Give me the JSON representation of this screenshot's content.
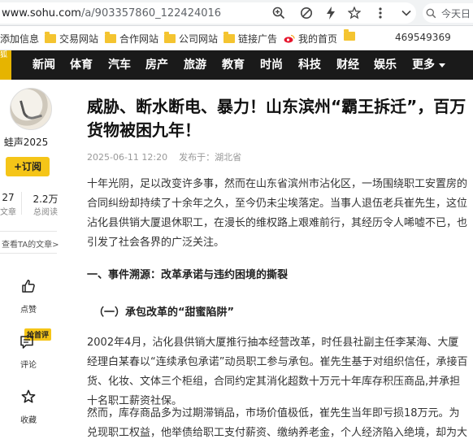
{
  "browser": {
    "url_host": "www.sohu.com",
    "url_path": "/a/903357860_122424016",
    "search_hint": "今天日"
  },
  "bookmarks": [
    {
      "label": "添加信息",
      "folder": false
    },
    {
      "label": "交易网站",
      "folder": true
    },
    {
      "label": "合作网站",
      "folder": true
    },
    {
      "label": "公司网站",
      "folder": true
    },
    {
      "label": "链接广告",
      "folder": true
    },
    {
      "label": "我的首页",
      "folder": false
    },
    {
      "label": "",
      "folder": true
    },
    {
      "label": "469549369",
      "folder": false
    }
  ],
  "site": {
    "logo": "狐"
  },
  "nav": [
    "新闻",
    "体育",
    "汽车",
    "房产",
    "旅游",
    "教育",
    "时尚",
    "科技",
    "财经",
    "娱乐",
    "更多"
  ],
  "author": {
    "name": "蛙声2025",
    "follow_label": "+订阅",
    "articles_count": "27",
    "articles_label": "文章",
    "reads_count": "2.2万",
    "reads_label": "总阅读",
    "see_more": "查看TA的文章>"
  },
  "actions": {
    "like": "点赞",
    "comment": "评论",
    "comment_badge": "抢首评",
    "collect": "收藏"
  },
  "article": {
    "title": "威胁、断水断电、暴力！山东滨州“霸王拆迁”，百万货物被困九年！",
    "date": "2025-06-11 12:20",
    "source": "发布于：湖北省",
    "p1": "十年光阴，足以改变许多事，然而在山东省滨州市沾化区，一场围绕职工安置房的合同纠纷却持续了十余年之久，至今仍未尘埃落定。当事人退伍老兵崔先生，这位沾化县供销大厦退休职工，在漫长的维权路上艰难前行，其经历令人唏嘘不已，也引发了社会各界的广泛关注。",
    "h1": "一、事件溯源：改革承诺与违约困境的撕裂",
    "h2": "（一）承包改革的“甜蜜陷阱”",
    "p2": "2002年4月，沾化县供销大厦推行抽本经营改革，时任县社副主任李某海、大厦经理白某春以“连续承包承诺”动员职工参与承包。崔先生基于对组织信任，承接百货、化妆、文体三个柜组，合同约定其消化超数十万元十年库存积压商品,并承担十名职工薪资社保。",
    "p3": "然而，库存商品多为过期滞销品，市场价值极低，崔先生当年即亏损18万元。为兑现职工权益，他举债给职工支付薪资、缴纳养老金，个人经济陷入绝境，却为大厦减轻了沉重负"
  }
}
